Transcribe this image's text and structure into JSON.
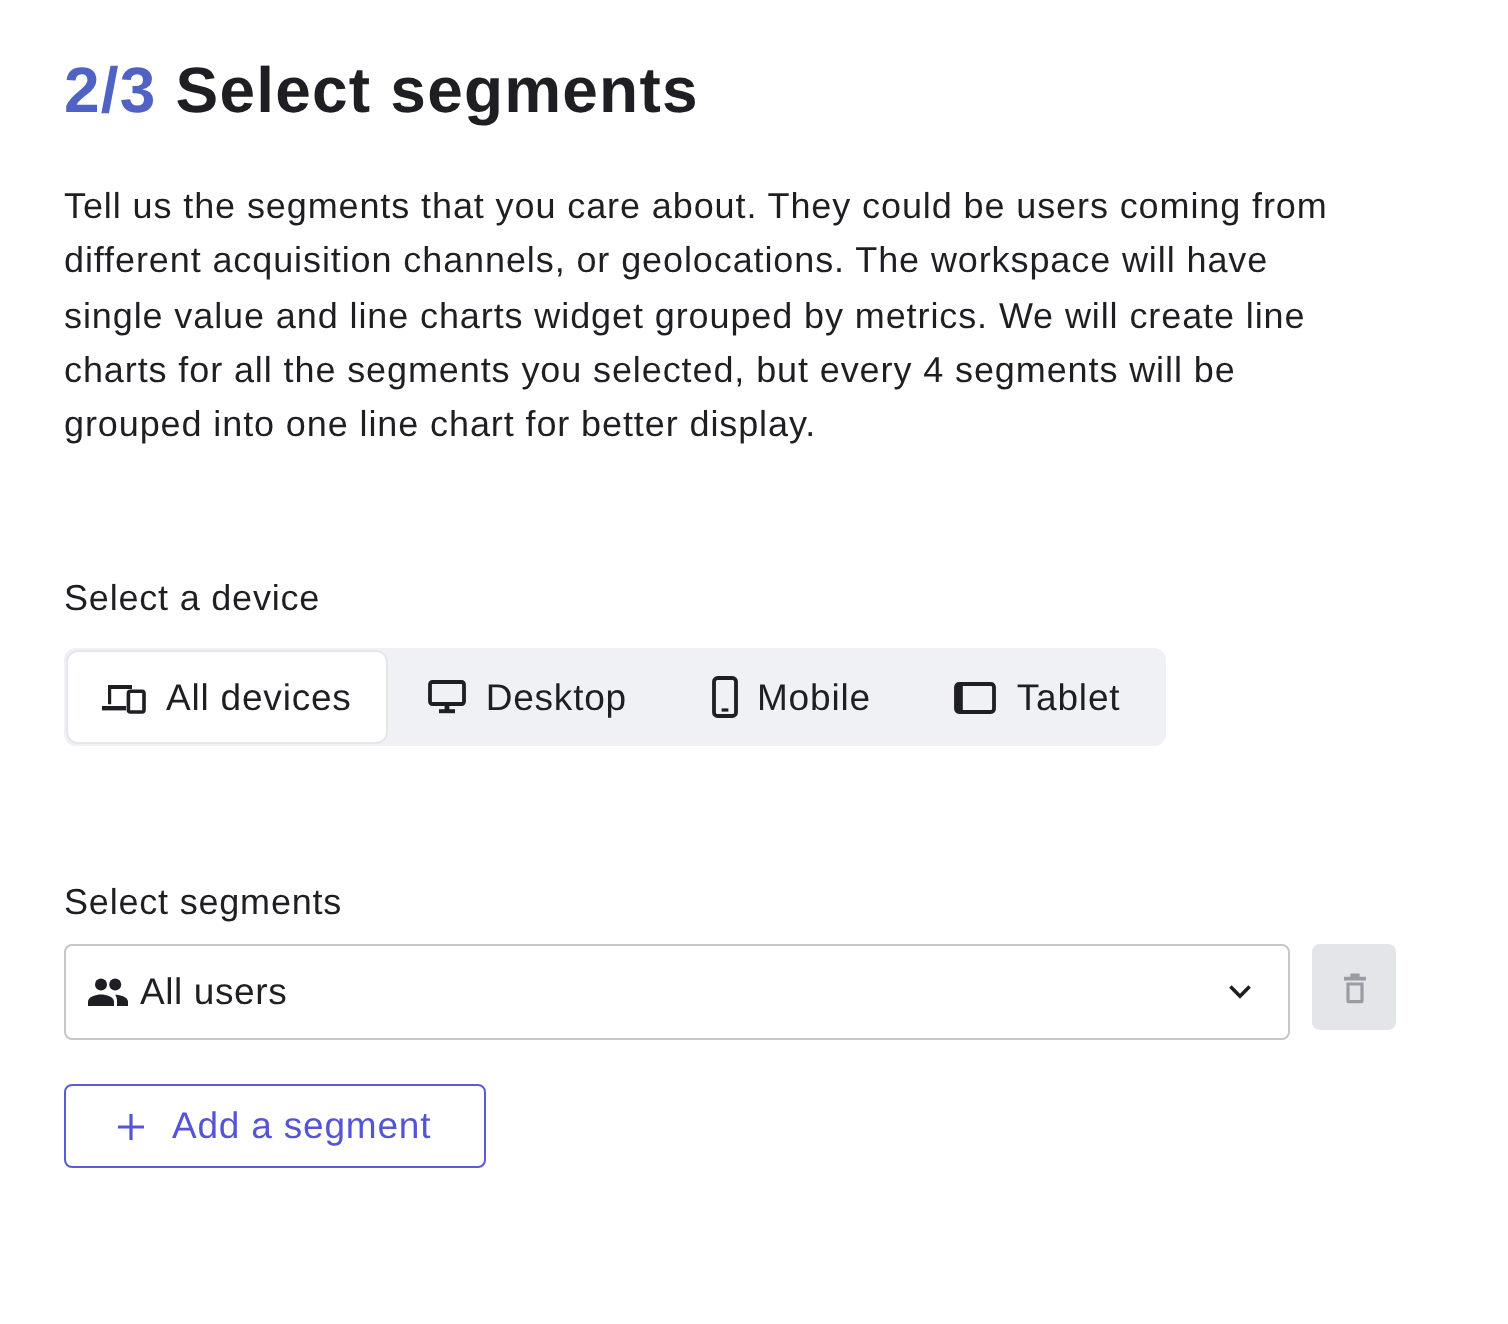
{
  "heading": {
    "step": "2/3",
    "title": "Select segments"
  },
  "description": "Tell us the segments that you care about. They could be users coming from different acquisition channels, or geolocations. The workspace will have single value and line charts widget grouped by metrics. We will create line charts for all the segments you selected, but every 4 segments will be grouped into one line chart for better display.",
  "device_picker": {
    "label": "Select a device",
    "options": [
      {
        "label": "All devices",
        "kind": "all",
        "selected": true
      },
      {
        "label": "Desktop",
        "kind": "desktop",
        "selected": false
      },
      {
        "label": "Mobile",
        "kind": "mobile",
        "selected": false
      },
      {
        "label": "Tablet",
        "kind": "tablet",
        "selected": false
      }
    ]
  },
  "segments": {
    "label": "Select segments",
    "items": [
      {
        "value": "All users",
        "delete_disabled": true
      }
    ],
    "add_button": "Add a segment"
  }
}
